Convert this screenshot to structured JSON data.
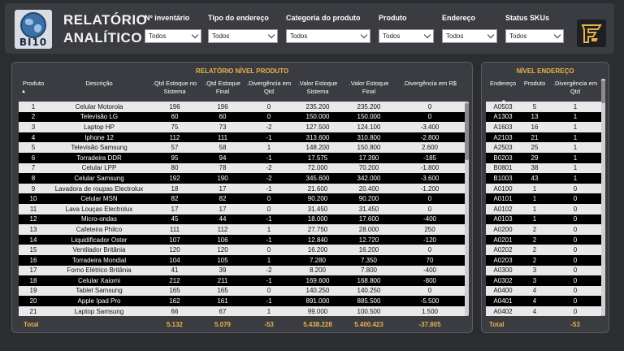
{
  "header": {
    "logo_text": "BI10",
    "title_line1": "RELATÓRIO",
    "title_line2": "ANALÍTICO"
  },
  "filters": [
    {
      "label": "Nº inventário",
      "value": "Todos"
    },
    {
      "label": "Tipo do endereço",
      "value": "Todos"
    },
    {
      "label": "Categoria do produto",
      "value": "Todos"
    },
    {
      "label": "Produto",
      "value": "Todos"
    },
    {
      "label": "Endereço",
      "value": "Todos"
    },
    {
      "label": "Status SKUs",
      "value": "Todos"
    }
  ],
  "product_report": {
    "title": "RELATÓRIO NÍVEL PRODUTO",
    "headers": [
      "Produto",
      "Descrição",
      ".Qtd Estoque no Sistema",
      ".Qtd Estoque Final",
      ".Divergência em Qtd",
      ".Valor Estoque Sistema",
      ".Valor Estoque Final",
      ".Divergência em R$"
    ],
    "rows": [
      [
        "1",
        "Celular Motorola",
        "196",
        "196",
        "0",
        "235.200",
        "235.200",
        "0"
      ],
      [
        "2",
        "Televisão LG",
        "60",
        "60",
        "0",
        "150.000",
        "150.000",
        "0"
      ],
      [
        "3",
        "Laptop HP",
        "75",
        "73",
        "-2",
        "127.500",
        "124.100",
        "-3.400"
      ],
      [
        "4",
        "Iphone 12",
        "112",
        "111",
        "-1",
        "313.600",
        "310.800",
        "-2.800"
      ],
      [
        "5",
        "Televisão Samsung",
        "57",
        "58",
        "1",
        "148.200",
        "150.800",
        "2.600"
      ],
      [
        "6",
        "Torradeira DDR",
        "95",
        "94",
        "-1",
        "17.575",
        "17.390",
        "-185"
      ],
      [
        "7",
        "Celular LPP",
        "80",
        "78",
        "-2",
        "72.000",
        "70.200",
        "-1.800"
      ],
      [
        "8",
        "Celular Samsung",
        "192",
        "190",
        "-2",
        "345.600",
        "342.000",
        "-3.600"
      ],
      [
        "9",
        "Lavadora de roupas Electrolux",
        "18",
        "17",
        "-1",
        "21.600",
        "20.400",
        "-1.200"
      ],
      [
        "10",
        "Celular MSN",
        "82",
        "82",
        "0",
        "90.200",
        "90.200",
        "0"
      ],
      [
        "11",
        "Lava Louças Electrolux",
        "17",
        "17",
        "0",
        "31.450",
        "31.450",
        "0"
      ],
      [
        "12",
        "Micro-ondas",
        "45",
        "44",
        "-1",
        "18.000",
        "17.600",
        "-400"
      ],
      [
        "13",
        "Cafeteira Philco",
        "111",
        "112",
        "1",
        "27.750",
        "28.000",
        "250"
      ],
      [
        "14",
        "Liquidificador Oster",
        "107",
        "106",
        "-1",
        "12.840",
        "12.720",
        "-120"
      ],
      [
        "15",
        "Ventilador Britânia",
        "120",
        "120",
        "0",
        "16.200",
        "16.200",
        "0"
      ],
      [
        "16",
        "Torradeira Mondial",
        "104",
        "105",
        "1",
        "7.280",
        "7.350",
        "70"
      ],
      [
        "17",
        "Forno Elétrico Britânia",
        "41",
        "39",
        "-2",
        "8.200",
        "7.800",
        "-400"
      ],
      [
        "18",
        "Celular Xaiomi",
        "212",
        "211",
        "-1",
        "169.600",
        "168.800",
        "-800"
      ],
      [
        "19",
        "Tablet Samsung",
        "165",
        "165",
        "0",
        "140.250",
        "140.250",
        "0"
      ],
      [
        "20",
        "Apple Ipad Pro",
        "162",
        "161",
        "-1",
        "891.000",
        "885.500",
        "-5.500"
      ],
      [
        "21",
        "Laptop Samsung",
        "66",
        "67",
        "1",
        "99.000",
        "100.500",
        "1.500"
      ]
    ],
    "total": {
      "label": "Total",
      "qtd_sistema": "5.132",
      "qtd_final": "5.079",
      "div_qtd": "-53",
      "valor_sistema": "5.438.228",
      "valor_final": "5.400.423",
      "div_valor": "-37.805"
    }
  },
  "address_report": {
    "title": "NÍVEL ENDEREÇO",
    "headers": [
      "Endereço",
      "Produto",
      ".Divergência em Qtd"
    ],
    "rows": [
      [
        "A0503",
        "5",
        "1"
      ],
      [
        "A1303",
        "13",
        "1"
      ],
      [
        "A1603",
        "16",
        "1"
      ],
      [
        "A2103",
        "21",
        "1"
      ],
      [
        "A2503",
        "25",
        "1"
      ],
      [
        "B0203",
        "29",
        "1"
      ],
      [
        "B0801",
        "38",
        "1"
      ],
      [
        "B1003",
        "43",
        "1"
      ],
      [
        "A0100",
        "1",
        "0"
      ],
      [
        "A0101",
        "1",
        "0"
      ],
      [
        "A0102",
        "1",
        "0"
      ],
      [
        "A0103",
        "1",
        "0"
      ],
      [
        "A0200",
        "2",
        "0"
      ],
      [
        "A0201",
        "2",
        "0"
      ],
      [
        "A0202",
        "2",
        "0"
      ],
      [
        "A0203",
        "2",
        "0"
      ],
      [
        "A0300",
        "3",
        "0"
      ],
      [
        "A0302",
        "3",
        "0"
      ],
      [
        "A0400",
        "4",
        "0"
      ],
      [
        "A0401",
        "4",
        "0"
      ],
      [
        "A0402",
        "4",
        "0"
      ]
    ],
    "total": {
      "label": "Total",
      "div_qtd": "-53"
    }
  }
}
